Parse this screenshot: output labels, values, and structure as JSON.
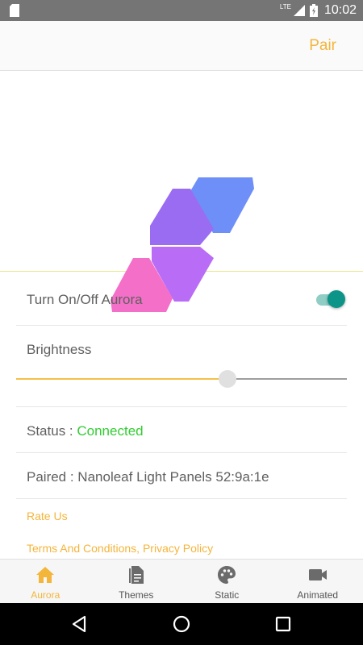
{
  "status_bar": {
    "network": "LTE",
    "time": "10:02"
  },
  "app_bar": {
    "pair_label": "Pair"
  },
  "hero": {
    "panel_colors": [
      "#6e8ff7",
      "#9a6cf2",
      "#b96cf5",
      "#f46fc8"
    ]
  },
  "controls": {
    "power_label": "Turn On/Off Aurora",
    "power_on": true,
    "brightness_label": "Brightness",
    "brightness_fraction": 0.64,
    "status_prefix": "Status : ",
    "status_value": "Connected",
    "paired_text": "Paired : Nanoleaf Light Panels 52:9a:1e"
  },
  "links": {
    "rate_us": "Rate Us",
    "terms": "Terms And Conditions, Privacy Policy"
  },
  "bottom_nav": {
    "items": [
      {
        "label": "Aurora",
        "icon": "home-icon",
        "active": true
      },
      {
        "label": "Themes",
        "icon": "document-icon",
        "active": false
      },
      {
        "label": "Static",
        "icon": "palette-icon",
        "active": false
      },
      {
        "label": "Animated",
        "icon": "videocam-icon",
        "active": false
      }
    ]
  },
  "colors": {
    "accent": "#f4b53b",
    "toggle_on": "#0d9488",
    "connected": "#33cc33"
  }
}
